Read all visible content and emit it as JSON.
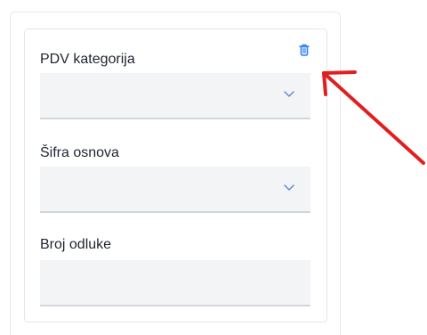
{
  "form": {
    "fields": [
      {
        "label": "PDV kategorija",
        "value": "",
        "type": "select"
      },
      {
        "label": "Šifra osnova",
        "value": "",
        "type": "select"
      },
      {
        "label": "Broj odluke",
        "value": "",
        "type": "text"
      }
    ],
    "delete_icon": "trash-icon",
    "accent_color": "#2f80ed"
  },
  "annotation": {
    "icon": "red-arrow-icon",
    "color": "#e02020"
  }
}
